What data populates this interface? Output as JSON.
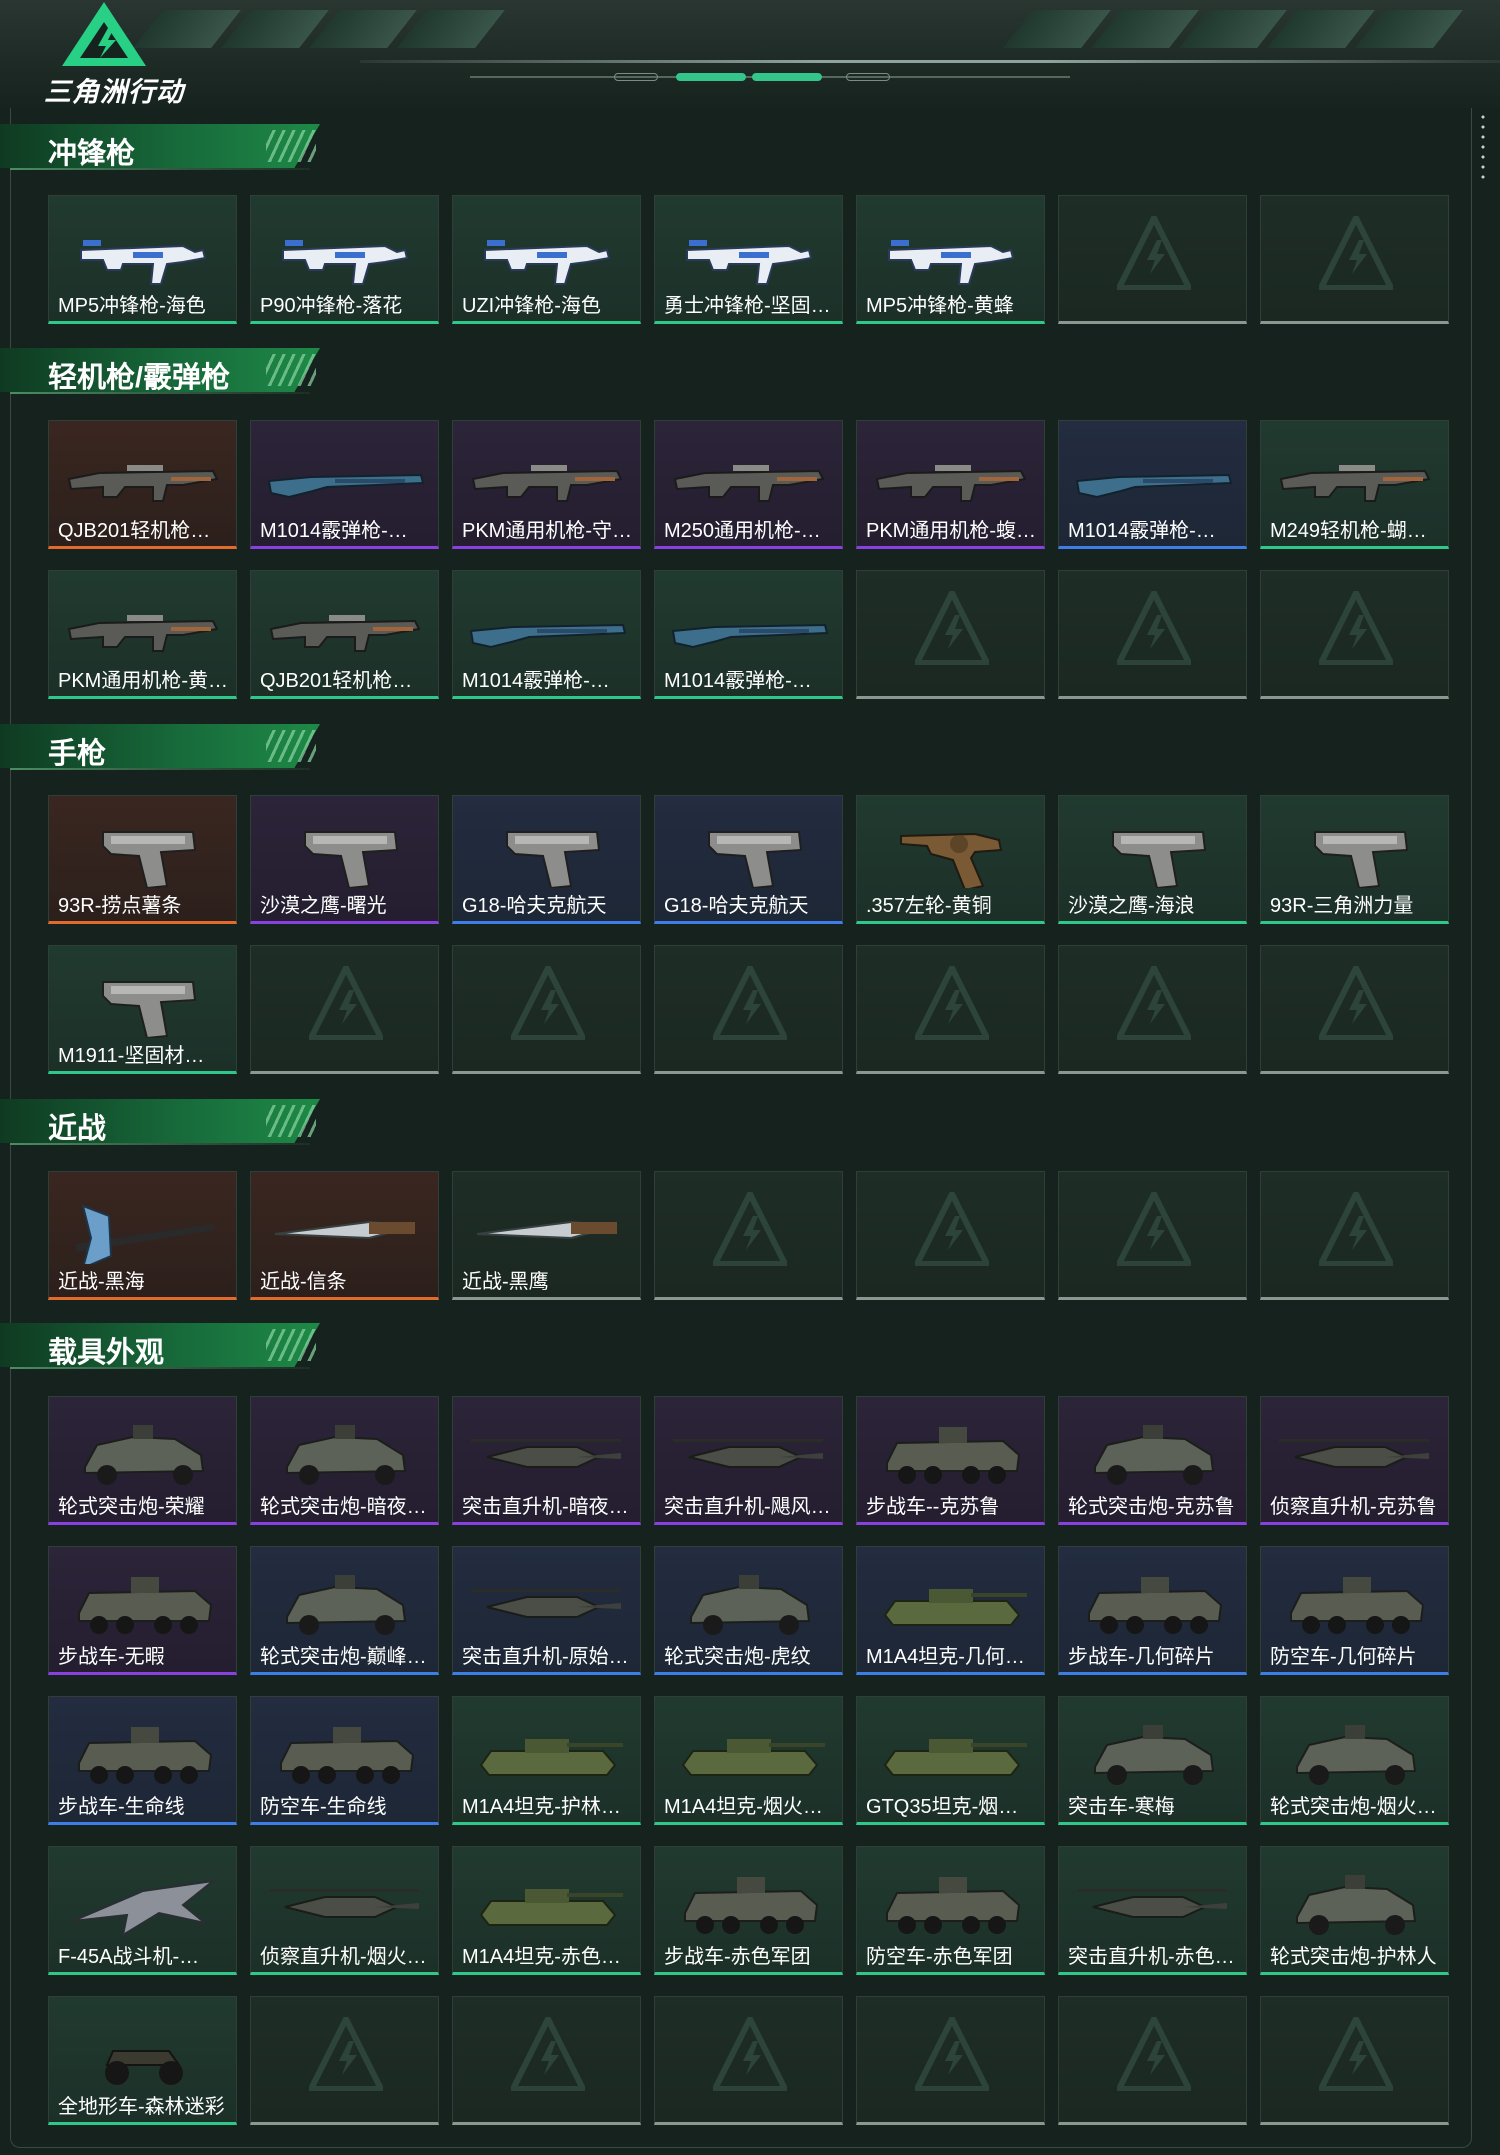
{
  "brand": {
    "name": "三角洲行动"
  },
  "colors": {
    "green": "#2ec98a",
    "blue": "#3c7de8",
    "purple": "#8a3fe0",
    "orange": "#e26a2c",
    "empty": "#8d9792"
  },
  "sections": [
    {
      "title": "冲锋枪",
      "items": [
        {
          "name": "MP5冲锋枪-海色",
          "rarity": "green",
          "kind": "smg"
        },
        {
          "name": "P90冲锋枪-落花",
          "rarity": "green",
          "kind": "smg"
        },
        {
          "name": "UZI冲锋枪-海色",
          "rarity": "green",
          "kind": "smg"
        },
        {
          "name": "勇士冲锋枪-坚固材…",
          "rarity": "green",
          "kind": "smg"
        },
        {
          "name": "MP5冲锋枪-黄蜂",
          "rarity": "green",
          "kind": "smg"
        },
        {
          "name": "",
          "rarity": "empty",
          "kind": "empty"
        },
        {
          "name": "",
          "rarity": "empty",
          "kind": "empty"
        }
      ]
    },
    {
      "title": "轻机枪/霰弹枪",
      "items": [
        {
          "name": "QJB201轻机枪…",
          "rarity": "orange",
          "kind": "lmg"
        },
        {
          "name": "M1014霰弹枪-…",
          "rarity": "purple",
          "kind": "shotgun"
        },
        {
          "name": "PKM通用机枪-守…",
          "rarity": "purple",
          "kind": "lmg"
        },
        {
          "name": "M250通用机枪-…",
          "rarity": "purple",
          "kind": "lmg"
        },
        {
          "name": "PKM通用机枪-蝮…",
          "rarity": "purple",
          "kind": "lmg"
        },
        {
          "name": "M1014霰弹枪-…",
          "rarity": "blue",
          "kind": "shotgun"
        },
        {
          "name": "M249轻机枪-蝴…",
          "rarity": "green",
          "kind": "lmg"
        },
        {
          "name": "PKM通用机枪-黄…",
          "rarity": "green",
          "kind": "lmg"
        },
        {
          "name": "QJB201轻机枪…",
          "rarity": "green",
          "kind": "lmg"
        },
        {
          "name": "M1014霰弹枪-…",
          "rarity": "green",
          "kind": "shotgun"
        },
        {
          "name": "M1014霰弹枪-…",
          "rarity": "green",
          "kind": "shotgun"
        },
        {
          "name": "",
          "rarity": "empty",
          "kind": "empty"
        },
        {
          "name": "",
          "rarity": "empty",
          "kind": "empty"
        },
        {
          "name": "",
          "rarity": "empty",
          "kind": "empty"
        }
      ]
    },
    {
      "title": "手枪",
      "items": [
        {
          "name": "93R-捞点薯条",
          "rarity": "orange",
          "kind": "pistol"
        },
        {
          "name": "沙漠之鹰-曙光",
          "rarity": "purple",
          "kind": "pistol"
        },
        {
          "name": "G18-哈夫克航天",
          "rarity": "blue",
          "kind": "pistol"
        },
        {
          "name": "G18-哈夫克航天",
          "rarity": "blue",
          "kind": "pistol"
        },
        {
          "name": ".357左轮-黄铜",
          "rarity": "green",
          "kind": "revolver"
        },
        {
          "name": "沙漠之鹰-海浪",
          "rarity": "green",
          "kind": "pistol"
        },
        {
          "name": "93R-三角洲力量",
          "rarity": "green",
          "kind": "pistol"
        },
        {
          "name": "M1911-坚固材…",
          "rarity": "green",
          "kind": "pistol"
        },
        {
          "name": "",
          "rarity": "empty",
          "kind": "empty"
        },
        {
          "name": "",
          "rarity": "empty",
          "kind": "empty"
        },
        {
          "name": "",
          "rarity": "empty",
          "kind": "empty"
        },
        {
          "name": "",
          "rarity": "empty",
          "kind": "empty"
        },
        {
          "name": "",
          "rarity": "empty",
          "kind": "empty"
        },
        {
          "name": "",
          "rarity": "empty",
          "kind": "empty"
        }
      ]
    },
    {
      "title": "近战",
      "items": [
        {
          "name": "近战-黑海",
          "rarity": "orange",
          "kind": "axe"
        },
        {
          "name": "近战-信条",
          "rarity": "orange",
          "kind": "knife"
        },
        {
          "name": "近战-黑鹰",
          "rarity": "empty",
          "kind": "knife"
        },
        {
          "name": "",
          "rarity": "empty",
          "kind": "empty"
        },
        {
          "name": "",
          "rarity": "empty",
          "kind": "empty"
        },
        {
          "name": "",
          "rarity": "empty",
          "kind": "empty"
        },
        {
          "name": "",
          "rarity": "empty",
          "kind": "empty"
        }
      ]
    },
    {
      "title": "载具外观",
      "items": [
        {
          "name": "轮式突击炮-荣耀",
          "rarity": "purple",
          "kind": "car"
        },
        {
          "name": "轮式突击炮-暗夜行…",
          "rarity": "purple",
          "kind": "car"
        },
        {
          "name": "突击直升机-暗夜行…",
          "rarity": "purple",
          "kind": "heli"
        },
        {
          "name": "突击直升机-飓风行…",
          "rarity": "purple",
          "kind": "heli"
        },
        {
          "name": "步战车--克苏鲁",
          "rarity": "purple",
          "kind": "apc"
        },
        {
          "name": "轮式突击炮-克苏鲁",
          "rarity": "purple",
          "kind": "car"
        },
        {
          "name": "侦察直升机-克苏鲁",
          "rarity": "purple",
          "kind": "heli"
        },
        {
          "name": "步战车-无暇",
          "rarity": "purple",
          "kind": "apc"
        },
        {
          "name": "轮式突击炮-巅峰竞…",
          "rarity": "blue",
          "kind": "car"
        },
        {
          "name": "突击直升机-原始伪…",
          "rarity": "blue",
          "kind": "heli"
        },
        {
          "name": "轮式突击炮-虎纹",
          "rarity": "blue",
          "kind": "car"
        },
        {
          "name": "M1A4坦克-几何…",
          "rarity": "blue",
          "kind": "tank"
        },
        {
          "name": "步战车-几何碎片",
          "rarity": "blue",
          "kind": "apc"
        },
        {
          "name": "防空车-几何碎片",
          "rarity": "blue",
          "kind": "apc"
        },
        {
          "name": "步战车-生命线",
          "rarity": "blue",
          "kind": "apc"
        },
        {
          "name": "防空车-生命线",
          "rarity": "blue",
          "kind": "apc"
        },
        {
          "name": "M1A4坦克-护林…",
          "rarity": "green",
          "kind": "tank"
        },
        {
          "name": "M1A4坦克-烟火…",
          "rarity": "green",
          "kind": "tank"
        },
        {
          "name": "GTQ35坦克-烟…",
          "rarity": "green",
          "kind": "tank"
        },
        {
          "name": "突击车-寒梅",
          "rarity": "green",
          "kind": "car"
        },
        {
          "name": "轮式突击炮-烟火2…",
          "rarity": "green",
          "kind": "car"
        },
        {
          "name": "F-45A战斗机-…",
          "rarity": "green",
          "kind": "jet"
        },
        {
          "name": "侦察直升机-烟火2…",
          "rarity": "green",
          "kind": "heli"
        },
        {
          "name": "M1A4坦克-赤色…",
          "rarity": "green",
          "kind": "tank"
        },
        {
          "name": "步战车-赤色军团",
          "rarity": "green",
          "kind": "apc"
        },
        {
          "name": "防空车-赤色军团",
          "rarity": "green",
          "kind": "apc"
        },
        {
          "name": "突击直升机-赤色军…",
          "rarity": "green",
          "kind": "heli"
        },
        {
          "name": "轮式突击炮-护林人",
          "rarity": "green",
          "kind": "car"
        },
        {
          "name": "全地形车-森林迷彩",
          "rarity": "green",
          "kind": "atv"
        },
        {
          "name": "",
          "rarity": "empty",
          "kind": "empty"
        },
        {
          "name": "",
          "rarity": "empty",
          "kind": "empty"
        },
        {
          "name": "",
          "rarity": "empty",
          "kind": "empty"
        },
        {
          "name": "",
          "rarity": "empty",
          "kind": "empty"
        },
        {
          "name": "",
          "rarity": "empty",
          "kind": "empty"
        },
        {
          "name": "",
          "rarity": "empty",
          "kind": "empty"
        }
      ]
    }
  ]
}
